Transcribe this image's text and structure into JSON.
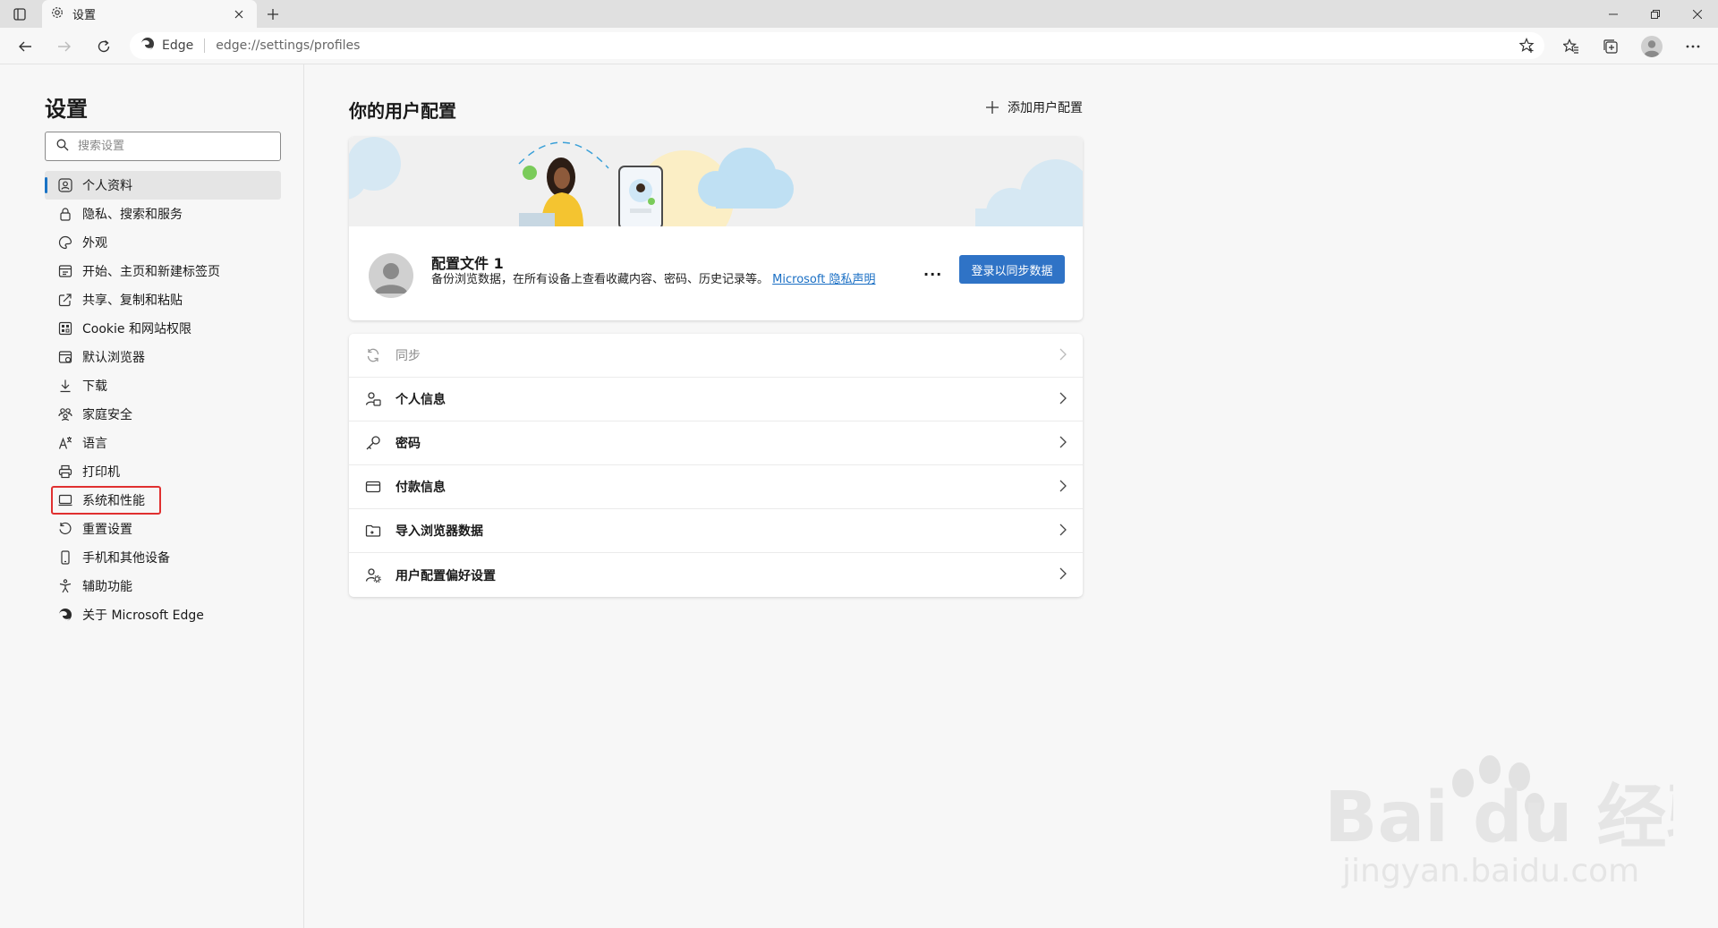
{
  "tab": {
    "title": "设置"
  },
  "address": {
    "site_label": "Edge",
    "url": "edge://settings/profiles"
  },
  "sidebar": {
    "title": "设置",
    "search_placeholder": "搜索设置",
    "items": [
      {
        "label": "个人资料",
        "icon": "profile-icon",
        "active": true
      },
      {
        "label": "隐私、搜索和服务",
        "icon": "lock-icon"
      },
      {
        "label": "外观",
        "icon": "appearance-icon"
      },
      {
        "label": "开始、主页和新建标签页",
        "icon": "home-icon"
      },
      {
        "label": "共享、复制和粘贴",
        "icon": "share-icon"
      },
      {
        "label": "Cookie 和网站权限",
        "icon": "site-permissions-icon"
      },
      {
        "label": "默认浏览器",
        "icon": "browser-icon"
      },
      {
        "label": "下载",
        "icon": "download-icon"
      },
      {
        "label": "家庭安全",
        "icon": "family-icon"
      },
      {
        "label": "语言",
        "icon": "language-icon"
      },
      {
        "label": "打印机",
        "icon": "printer-icon"
      },
      {
        "label": "系统和性能",
        "icon": "system-icon",
        "highlighted": true
      },
      {
        "label": "重置设置",
        "icon": "reset-icon"
      },
      {
        "label": "手机和其他设备",
        "icon": "phone-icon"
      },
      {
        "label": "辅助功能",
        "icon": "accessibility-icon"
      },
      {
        "label": "关于 Microsoft Edge",
        "icon": "edge-logo-icon"
      }
    ]
  },
  "main": {
    "title": "你的用户配置",
    "add_profile": "添加用户配置",
    "profile": {
      "name": "配置文件 1",
      "description": "备份浏览数据，在所有设备上查看收藏内容、密码、历史记录等。",
      "privacy_link": "Microsoft 隐私声明",
      "more": "...",
      "signin_button": "登录以同步数据"
    },
    "rows": [
      {
        "label": "同步",
        "icon": "sync-icon",
        "disabled": true
      },
      {
        "label": "个人信息",
        "icon": "personal-info-icon"
      },
      {
        "label": "密码",
        "icon": "key-icon"
      },
      {
        "label": "付款信息",
        "icon": "card-icon"
      },
      {
        "label": "导入浏览器数据",
        "icon": "import-icon"
      },
      {
        "label": "用户配置偏好设置",
        "icon": "profile-prefs-icon"
      }
    ]
  },
  "watermark": {
    "brand": "Bai du 经验",
    "url": "jingyan.baidu.com"
  },
  "colors": {
    "accent": "#2f73c6",
    "highlight_box": "#e03030"
  }
}
